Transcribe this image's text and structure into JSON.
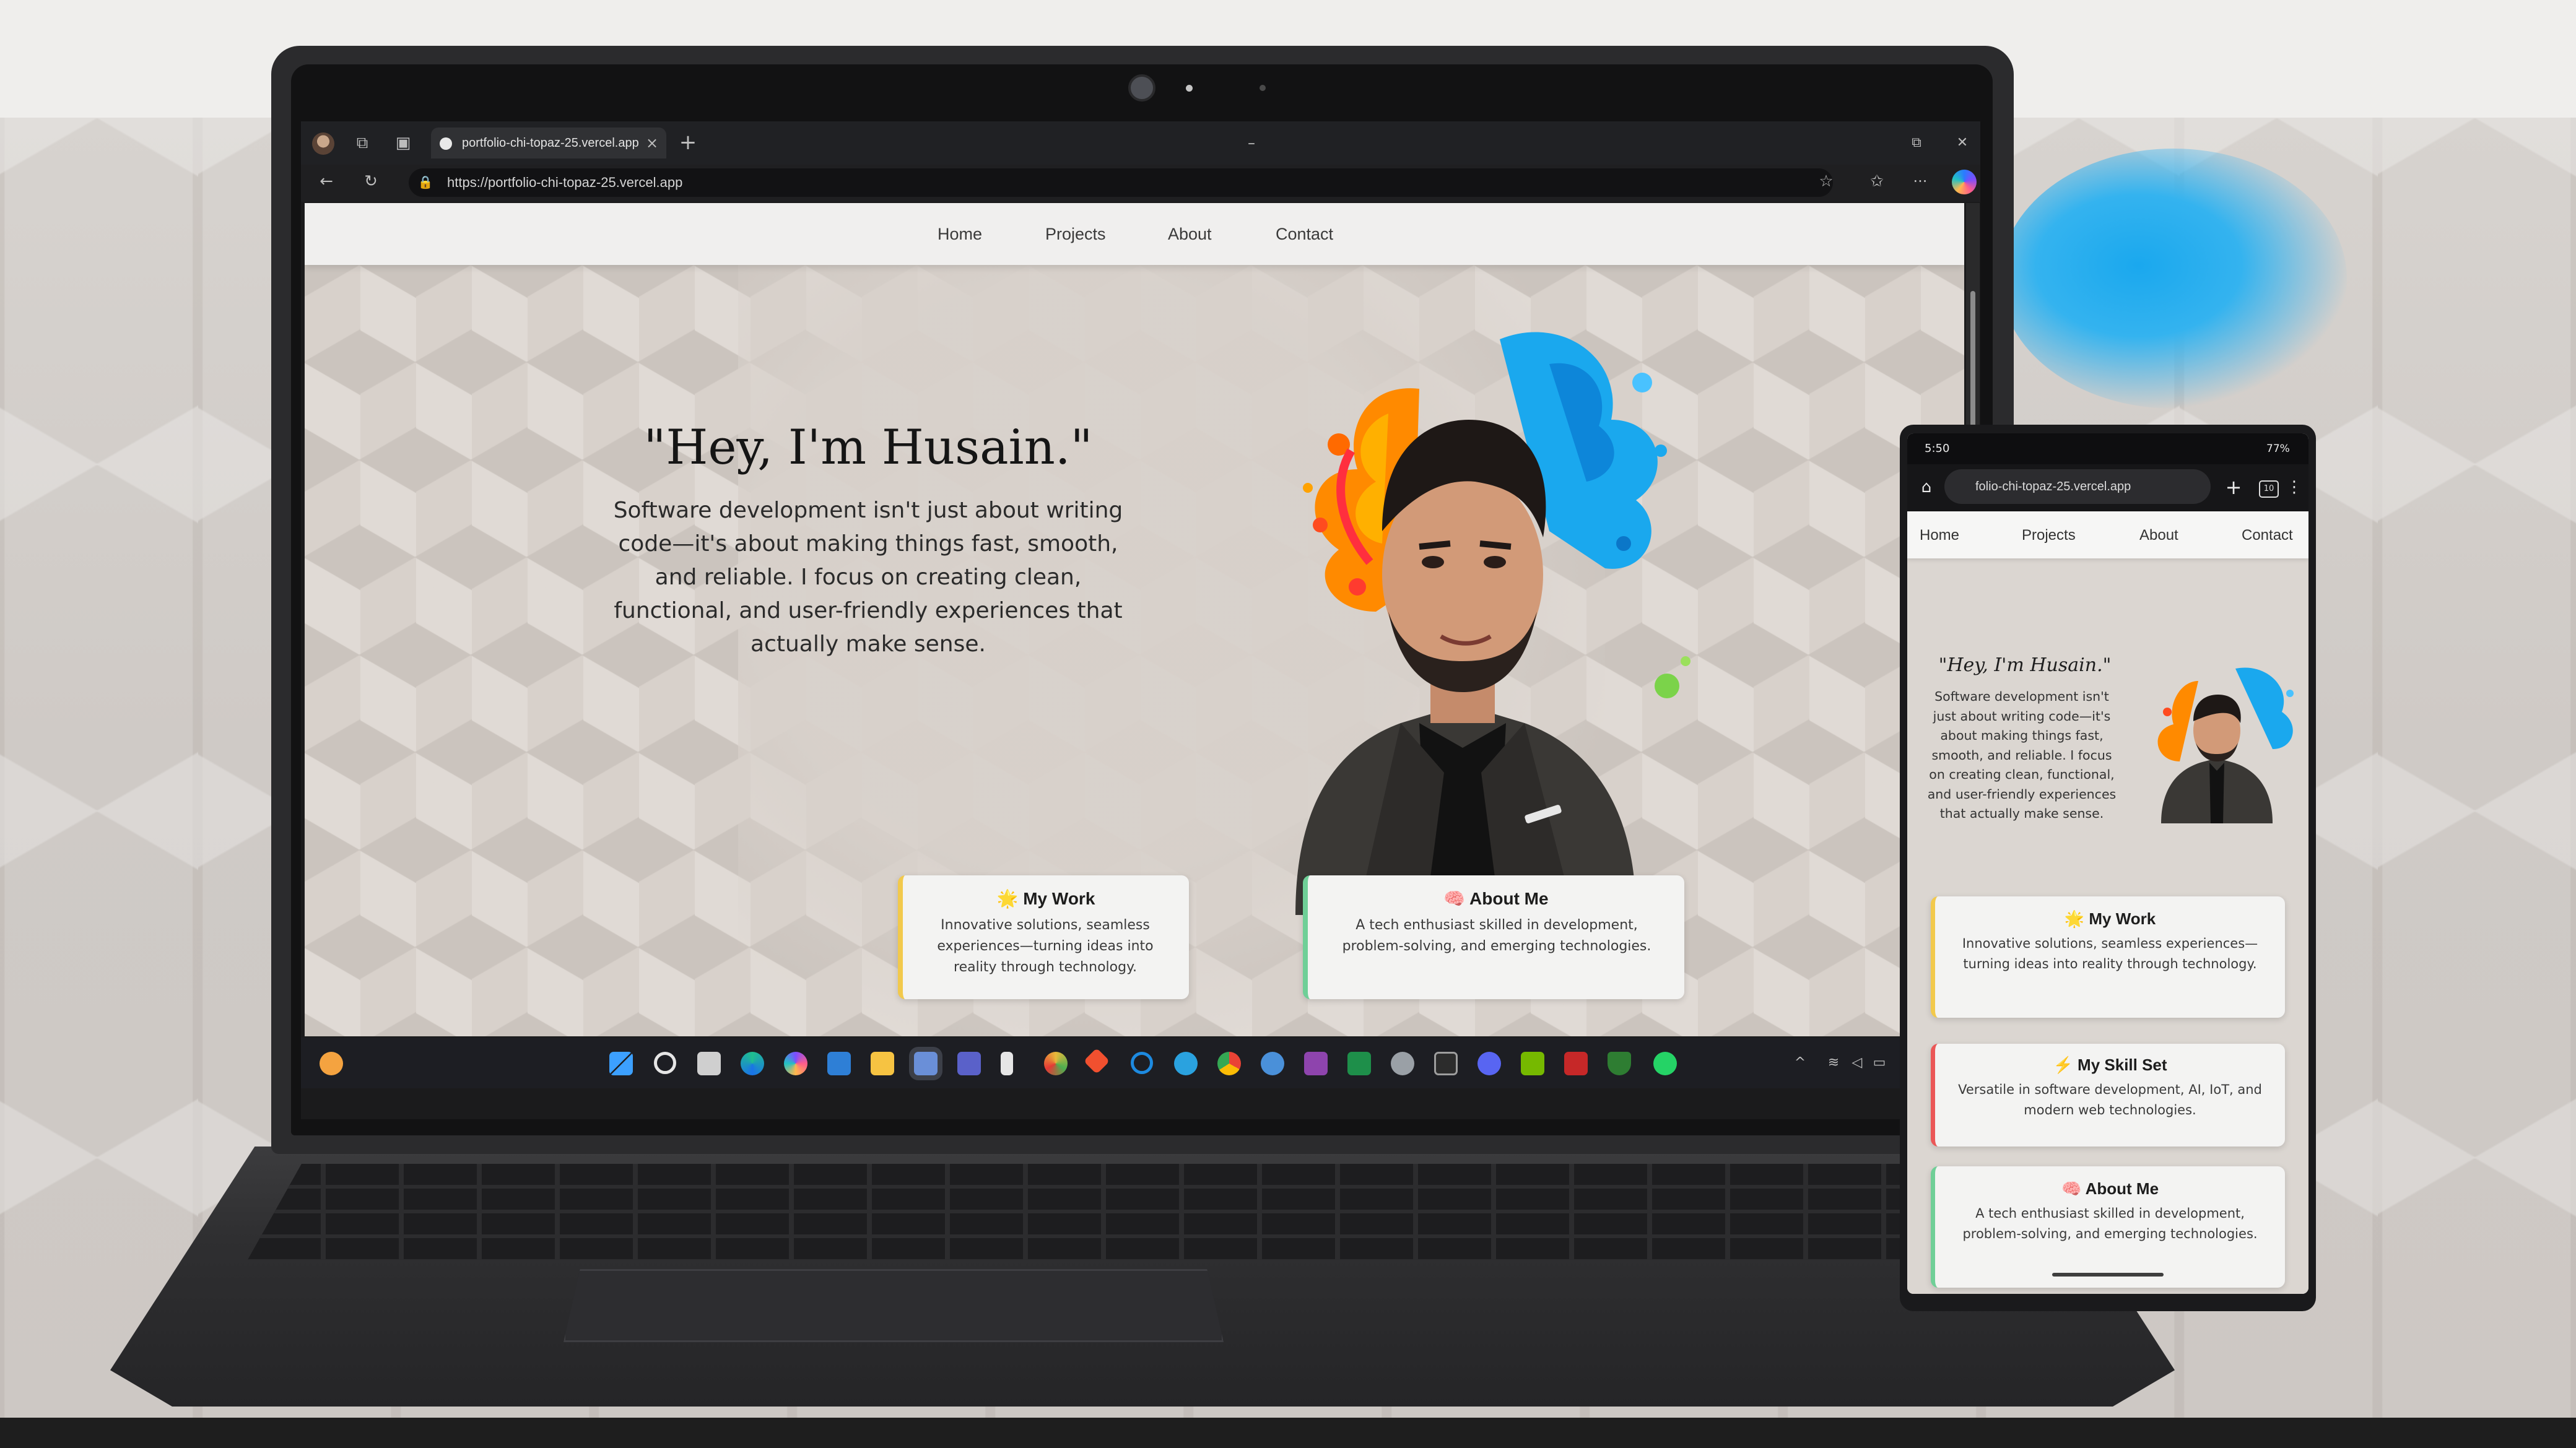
{
  "browser": {
    "tab_title": "portfolio-chi-topaz-25.vercel.app",
    "tab_close": "×",
    "new_tab": "+",
    "url": "https://portfolio-chi-topaz-25.vercel.app",
    "window_min": "–",
    "window_max": "⧉",
    "window_close": "✕",
    "more": "···"
  },
  "site": {
    "nav": [
      "Home",
      "Projects",
      "About",
      "Contact"
    ],
    "hero_title": "\"Hey, I'm Husain.\"",
    "hero_text": "Software development isn't just about writing code—it's about making things fast, smooth, and reliable. I focus on creating clean, functional, and user-friendly experiences that actually make sense.",
    "cards": [
      {
        "emoji": "🌟",
        "title": "My Work",
        "text": "Innovative solutions, seamless experiences—turning ideas into reality through technology.",
        "accent": "#f2c94c"
      },
      {
        "emoji": "⚡",
        "title": "My Skill Set",
        "text": "Versatile in software development, AI, IoT, and modern web technologies.",
        "accent": "#eb5757"
      },
      {
        "emoji": "🧠",
        "title": "About Me",
        "text": "A tech enthusiast skilled in development, problem-solving, and emerging technologies.",
        "accent": "#6fcf97"
      }
    ]
  },
  "phone": {
    "status_time": "5:50",
    "status_battery": "77%",
    "url": "folio-chi-topaz-25.vercel.app",
    "tabs_count": "10",
    "nav": [
      "Home",
      "Projects",
      "About",
      "Contact"
    ],
    "hero_title": "\"Hey, I'm Husain.\"",
    "hero_text": "Software development isn't just about writing code—it's about making things fast, smooth, and reliable. I focus on creating clean, functional, and user-friendly experiences that actually make sense."
  },
  "taskbar": {
    "apps": [
      "start",
      "search",
      "task-view",
      "edge",
      "copilot",
      "store",
      "file-explorer",
      "photos",
      "teams",
      "code-editor",
      "chrome-canary",
      "git",
      "edge-dev",
      "telegram",
      "chrome",
      "people",
      "visual-studio",
      "excel",
      "server-manager",
      "terminal",
      "discord",
      "nvidia",
      "calculator",
      "security",
      "whatsapp"
    ]
  },
  "colors": {
    "accent_work": "#f2c94c",
    "accent_skills": "#eb5757",
    "accent_about": "#6fcf97",
    "splash_orange": "#ff8a00",
    "splash_blue": "#1aa8ee"
  }
}
